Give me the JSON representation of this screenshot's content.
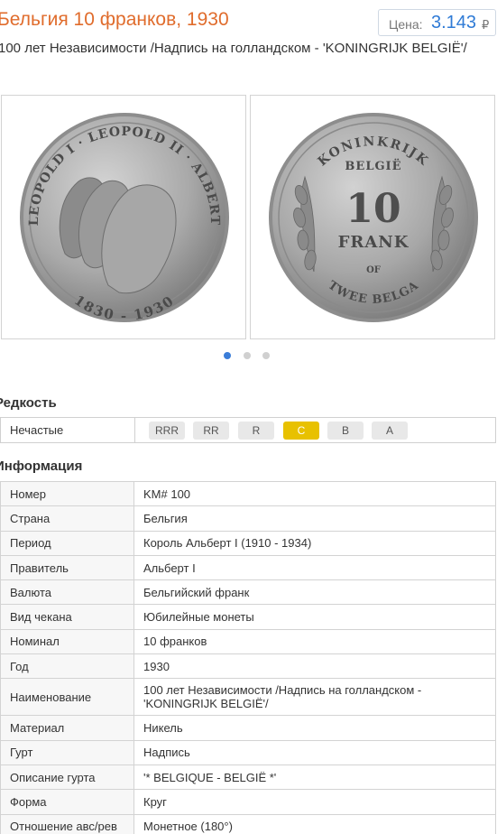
{
  "header": {
    "title": "Бельгия 10 франков, 1930",
    "price_label": "Цена:",
    "price_value": "3.143",
    "price_currency": "₽",
    "subtitle": "100 лет Независимости /Надпись на голландском - 'KONINGRIJK BELGIË'/"
  },
  "coins": {
    "obverse": {
      "legend_top": "LEOPOLD I · LEOPOLD II · ALBERT",
      "legend_bottom": "1830 - 1930"
    },
    "reverse": {
      "legend_top": "KONINKRIJK",
      "legend_country": "BELGIË",
      "denomination": "10",
      "unit": "FRANK",
      "of": "OF",
      "legend_bottom": "TWEE BELGA"
    }
  },
  "carousel": {
    "dots": 3,
    "active": 0,
    "active_color": "#3b7dd8"
  },
  "rarity": {
    "title": "Редкость",
    "label": "Нечастые",
    "options": [
      "RRR",
      "RR",
      "R",
      "C",
      "B",
      "A"
    ],
    "selected": "C"
  },
  "info": {
    "title": "Информация",
    "rows": [
      {
        "key": "Номер",
        "value": "KM# 100"
      },
      {
        "key": "Страна",
        "value": "Бельгия"
      },
      {
        "key": "Период",
        "value": "Король Альберт I (1910 - 1934)"
      },
      {
        "key": "Правитель",
        "value": "Альберт I"
      },
      {
        "key": "Валюта",
        "value": "Бельгийский франк"
      },
      {
        "key": "Вид чекана",
        "value": "Юбилейные монеты"
      },
      {
        "key": "Номинал",
        "value": "10 франков"
      },
      {
        "key": "Год",
        "value": "1930"
      },
      {
        "key": "Наименование",
        "value": "100 лет Независимости /Надпись на голландском - 'KONINGRIJK BELGIË'/"
      },
      {
        "key": "Материал",
        "value": "Никель"
      },
      {
        "key": "Гурт",
        "value": "Надпись"
      },
      {
        "key": "Описание гурта",
        "value": "'* BELGIQUE - BELGIË *'"
      },
      {
        "key": "Форма",
        "value": "Круг"
      },
      {
        "key": "Отношение авс/рев",
        "value": "Монетное (180°)"
      }
    ]
  },
  "colors": {
    "accent_orange": "#e06c2c",
    "price_blue": "#2f7bd6",
    "chip_active": "#e8c100"
  }
}
